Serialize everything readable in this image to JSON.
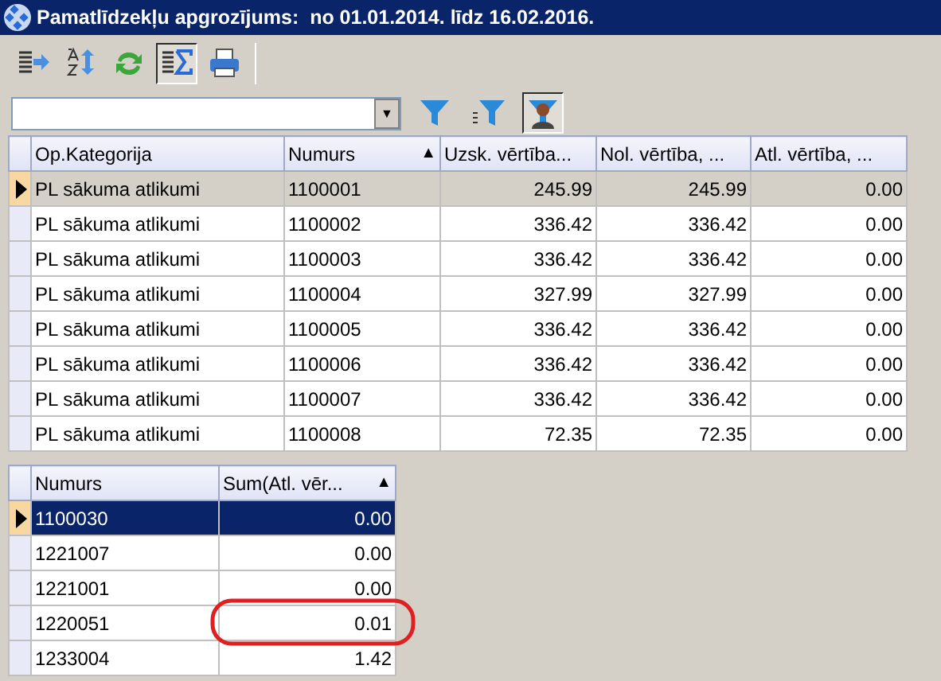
{
  "window": {
    "title": "Pamatlīdzekļu apgrozījums:  no 01.01.2014. līdz 16.02.2016."
  },
  "toolbar": [
    {
      "kind": "export",
      "pressed": false
    },
    {
      "kind": "sort",
      "pressed": false
    },
    {
      "kind": "refresh",
      "pressed": false
    },
    {
      "kind": "sum",
      "pressed": true
    },
    {
      "kind": "print",
      "pressed": false
    }
  ],
  "filter_bar": {
    "dropdown_arrow": "▼",
    "buttons": [
      {
        "kind": "filter",
        "pressed": false
      },
      {
        "kind": "filter-list",
        "pressed": false
      },
      {
        "kind": "filter-user",
        "pressed": true
      }
    ]
  },
  "main_table": {
    "columns": [
      {
        "label": "Op.Kategorija",
        "kind": "text"
      },
      {
        "label": "Numurs",
        "sort": "▲",
        "kind": "text"
      },
      {
        "label": "Uzsk. vērtība...",
        "kind": "amount"
      },
      {
        "label": "Nol. vērtība, ...",
        "kind": "amount"
      },
      {
        "label": "Atl. vērtība, ...",
        "kind": "amount"
      }
    ],
    "rows": [
      {
        "selected": true,
        "cells": [
          "PL sākuma atlikumi",
          "1100001",
          "245.99",
          "245.99",
          "0.00"
        ]
      },
      {
        "selected": false,
        "cells": [
          "PL sākuma atlikumi",
          "1100002",
          "336.42",
          "336.42",
          "0.00"
        ]
      },
      {
        "selected": false,
        "cells": [
          "PL sākuma atlikumi",
          "1100003",
          "336.42",
          "336.42",
          "0.00"
        ]
      },
      {
        "selected": false,
        "cells": [
          "PL sākuma atlikumi",
          "1100004",
          "327.99",
          "327.99",
          "0.00"
        ]
      },
      {
        "selected": false,
        "cells": [
          "PL sākuma atlikumi",
          "1100005",
          "336.42",
          "336.42",
          "0.00"
        ]
      },
      {
        "selected": false,
        "cells": [
          "PL sākuma atlikumi",
          "1100006",
          "336.42",
          "336.42",
          "0.00"
        ]
      },
      {
        "selected": false,
        "cells": [
          "PL sākuma atlikumi",
          "1100007",
          "336.42",
          "336.42",
          "0.00"
        ]
      },
      {
        "selected": false,
        "cells": [
          "PL sākuma atlikumi",
          "1100008",
          "72.35",
          "72.35",
          "0.00"
        ]
      }
    ]
  },
  "summary_table": {
    "columns": [
      {
        "label": "Numurs",
        "kind": "text"
      },
      {
        "label": "Sum(Atl. vēr...",
        "sort": "▲",
        "kind": "amount"
      }
    ],
    "rows": [
      {
        "selected": true,
        "circled": false,
        "cells": [
          "1100030",
          "0.00"
        ]
      },
      {
        "selected": false,
        "circled": false,
        "cells": [
          "1221007",
          "0.00"
        ]
      },
      {
        "selected": false,
        "circled": false,
        "cells": [
          "1221001",
          "0.00"
        ]
      },
      {
        "selected": false,
        "circled": true,
        "cells": [
          "1220051",
          "0.01"
        ]
      },
      {
        "selected": false,
        "circled": false,
        "cells": [
          "1233004",
          "1.42"
        ]
      }
    ]
  }
}
